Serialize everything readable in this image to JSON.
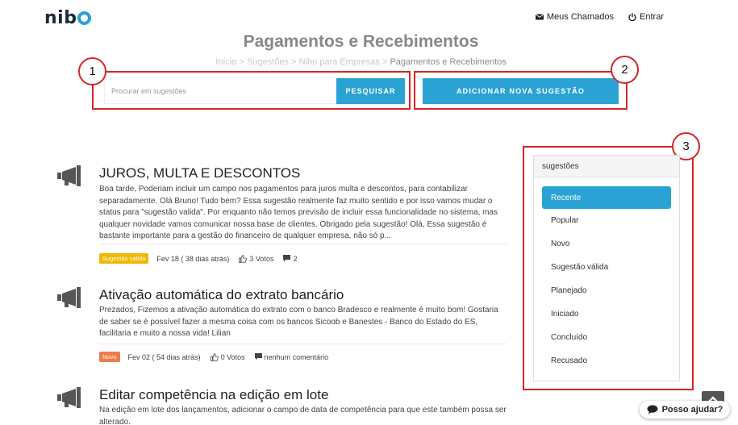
{
  "header": {
    "logo": "nib",
    "links": [
      {
        "label": "Meus Chamados",
        "icon": "envelope-icon"
      },
      {
        "label": "Entrar",
        "icon": "power-icon"
      }
    ]
  },
  "page": {
    "title": "Pagamentos e Recebimentos",
    "breadcrumb": {
      "parts": [
        "Início",
        "Sugestões",
        "Nibo para Empresas"
      ],
      "separator": " > ",
      "current": "Pagamentos e Recebimentos"
    }
  },
  "search": {
    "placeholder": "Procurar em sugestões",
    "button_label": "PESQUISAR"
  },
  "add_button_label": "ADICIONAR NOVA SUGESTÃO",
  "annotations": [
    "1",
    "2",
    "3"
  ],
  "posts": [
    {
      "title": "JUROS, MULTA E DESCONTOS",
      "text": "Boa tarde, Poderiam incluir um campo nos pagamentos para juros multa e descontos, para contabilizar separadamente. Olá Bruno! Tudo bem? Essa sugestão realmente faz muito sentido e por isso vamos mudar o status para \"sugestão valida\". Por enquanto não temos previsão de incluir essa funcionalidade no sistema, mas qualquer novidade vamos comunicar nossa base de clientes. Obrigado pela sugestão! Olá, Essa sugestão é bastante importante para a gestão do financeiro de qualquer empresa, não só p...",
      "badge": "Sugestão válida",
      "badge_color": "#f2b705",
      "date": "Fev 18 ( 38 dias atrás)",
      "votes": "3 Votos",
      "comments": "2"
    },
    {
      "title": "Ativação automática do extrato bancário",
      "text": "Prezados, Fizemos a ativação automática do extrato com o banco Bradesco e realmente é muito bom! Gostaria de saber se é possível fazer a mesma coisa com os bancos Sicoob e Banestes - Banco do Estado do ES, facilitaria e muito a nossa vida! Lilian",
      "badge": "Novo",
      "badge_color": "#f07a4a",
      "date": "Fev 02 ( 54 dias atrás)",
      "votes": "0 Votos",
      "comments": "nenhum comentário"
    },
    {
      "title": "Editar competência na edição em lote",
      "text": "Na edição em lote dos lançamentos, adicionar o campo de data de competência para que este também possa ser alterado."
    }
  ],
  "sidebar": {
    "title": "sugestões",
    "items": [
      "Recente",
      "Popular",
      "Novo",
      "Sugestão válida",
      "Planejado",
      "Iniciado",
      "Concluído",
      "Recusado"
    ],
    "active_index": 0
  },
  "help_label": "Posso ajudar?",
  "colors": {
    "accent": "#2aa3d4",
    "annotation": "#d6242a"
  }
}
